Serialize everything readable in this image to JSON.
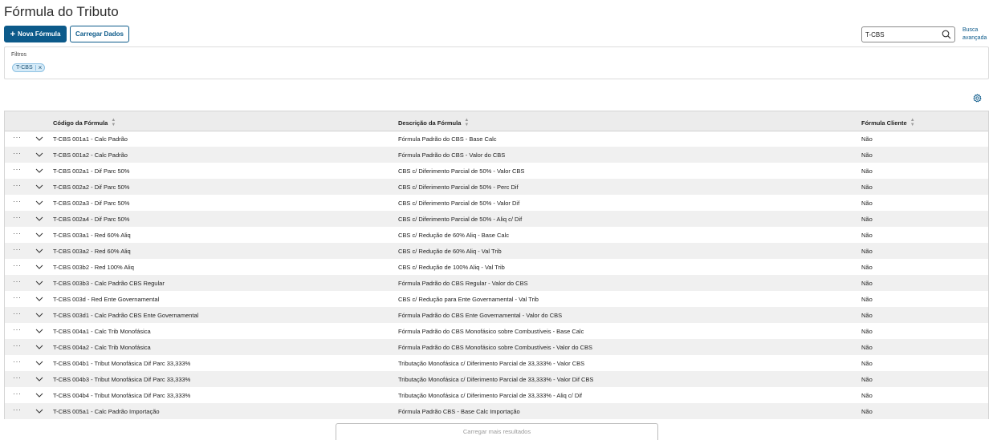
{
  "page": {
    "title": "Fórmula do Tributo"
  },
  "toolbar": {
    "new_label": "Nova Fórmula",
    "load_label": "Carregar Dados"
  },
  "search": {
    "value": "T-CBS",
    "advanced_line1": "Busca",
    "advanced_line2": "avançada"
  },
  "filters": {
    "label": "Filtros",
    "tags": [
      "T-CBS"
    ]
  },
  "table": {
    "columns": [
      "Código da Fórmula",
      "Descrição da Fórmula",
      "Fórmula Cliente"
    ],
    "rows": [
      {
        "code": "T-CBS 001a1 - Calc Padrão",
        "desc": "Fórmula Padrão do CBS - Base Calc",
        "client": "Não"
      },
      {
        "code": "T-CBS 001a2 - Calc Padrão",
        "desc": "Fórmula Padrão do CBS - Valor do CBS",
        "client": "Não"
      },
      {
        "code": "T-CBS 002a1 - Dif Parc 50%",
        "desc": "CBS c/ Diferimento Parcial de 50% - Valor CBS",
        "client": "Não"
      },
      {
        "code": "T-CBS 002a2 - Dif Parc 50%",
        "desc": "CBS c/ Diferimento Parcial de 50% - Perc Dif",
        "client": "Não"
      },
      {
        "code": "T-CBS 002a3 - Dif Parc 50%",
        "desc": "CBS c/ Diferimento Parcial de 50% - Valor Dif",
        "client": "Não"
      },
      {
        "code": "T-CBS 002a4 - Dif Parc 50%",
        "desc": "CBS c/ Diferimento Parcial de 50% - Aliq c/ Dif",
        "client": "Não"
      },
      {
        "code": "T-CBS 003a1 - Red 60% Aliq",
        "desc": "CBS c/ Redução de 60% Aliq - Base Calc",
        "client": "Não"
      },
      {
        "code": "T-CBS 003a2 - Red 60% Aliq",
        "desc": "CBS c/ Redução de 60% Aliq - Val Trib",
        "client": "Não"
      },
      {
        "code": "T-CBS 003b2 - Red 100% Aliq",
        "desc": "CBS c/ Redução de 100% Aliq - Val Trib",
        "client": "Não"
      },
      {
        "code": "T-CBS 003b3 - Calc Padrão CBS Regular",
        "desc": "Fórmula Padrão do CBS Regular - Valor do CBS",
        "client": "Não"
      },
      {
        "code": "T-CBS 003d - Red Ente Governamental",
        "desc": "CBS c/ Redução para Ente Governamental - Val Trib",
        "client": "Não"
      },
      {
        "code": "T-CBS 003d1 - Calc Padrão CBS Ente Governamental",
        "desc": "Fórmula Padrão do CBS Ente Governamental - Valor do CBS",
        "client": "Não"
      },
      {
        "code": "T-CBS 004a1 - Calc Trib Monofásica",
        "desc": "Fórmula Padrão do CBS Monofásico sobre Combustíveis - Base Calc",
        "client": "Não"
      },
      {
        "code": "T-CBS 004a2 - Calc Trib Monofásica",
        "desc": "Fórmula Padrão do CBS Monofásico sobre Combustíveis - Valor do CBS",
        "client": "Não"
      },
      {
        "code": "T-CBS 004b1 - Tribut Monofásica Dif Parc 33,333%",
        "desc": "Tributação Monofásica c/ Diferimento Parcial de 33,333% - Valor CBS",
        "client": "Não"
      },
      {
        "code": "T-CBS 004b3 - Tribut Monofásica Dif Parc 33,333%",
        "desc": "Tributação Monofásica c/ Diferimento Parcial de 33,333% - Valor Dif CBS",
        "client": "Não"
      },
      {
        "code": "T-CBS 004b4 - Tribut Monofásica Dif Parc 33,333%",
        "desc": "Tributação Monofásica c/ Diferimento Parcial de 33,333% - Aliq c/ Dif",
        "client": "Não"
      },
      {
        "code": "T-CBS 005a1 - Calc Padrão Importação",
        "desc": "Fórmula Padrão CBS - Base Calc Importação",
        "client": "Não"
      }
    ]
  },
  "load_more_label": "Carregar mais resultados",
  "colors": {
    "primary": "#0c5a8a",
    "tag_bg": "#d6ebf8"
  },
  "icons": {
    "search": "search-icon",
    "settings": "gear-icon",
    "row_menu": "more-horizontal-icon",
    "expand": "chevron-down-icon",
    "remove_tag": "close-icon"
  }
}
